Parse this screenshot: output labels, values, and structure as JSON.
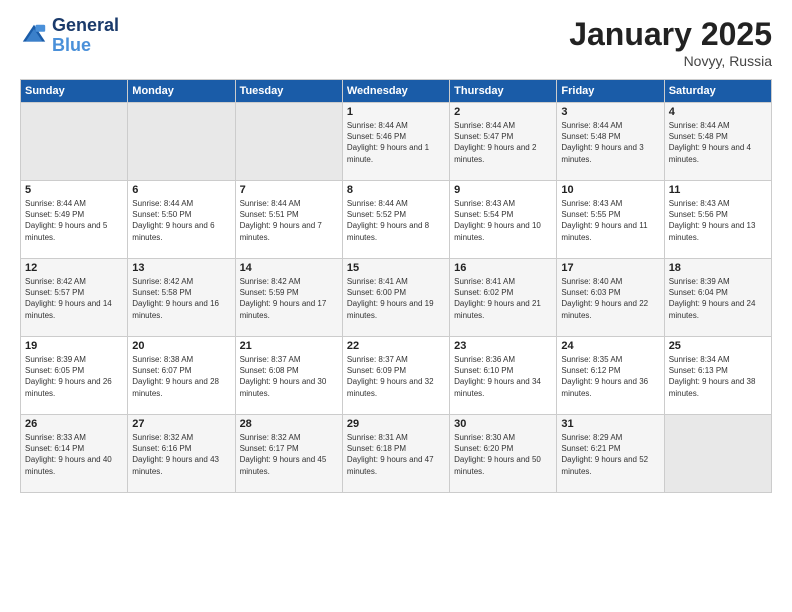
{
  "logo": {
    "text1": "General",
    "text2": "Blue"
  },
  "title": "January 2025",
  "subtitle": "Novyy, Russia",
  "days_of_week": [
    "Sunday",
    "Monday",
    "Tuesday",
    "Wednesday",
    "Thursday",
    "Friday",
    "Saturday"
  ],
  "weeks": [
    [
      {
        "day": "",
        "sunrise": "",
        "sunset": "",
        "daylight": ""
      },
      {
        "day": "",
        "sunrise": "",
        "sunset": "",
        "daylight": ""
      },
      {
        "day": "",
        "sunrise": "",
        "sunset": "",
        "daylight": ""
      },
      {
        "day": "1",
        "sunrise": "Sunrise: 8:44 AM",
        "sunset": "Sunset: 5:46 PM",
        "daylight": "Daylight: 9 hours and 1 minute."
      },
      {
        "day": "2",
        "sunrise": "Sunrise: 8:44 AM",
        "sunset": "Sunset: 5:47 PM",
        "daylight": "Daylight: 9 hours and 2 minutes."
      },
      {
        "day": "3",
        "sunrise": "Sunrise: 8:44 AM",
        "sunset": "Sunset: 5:48 PM",
        "daylight": "Daylight: 9 hours and 3 minutes."
      },
      {
        "day": "4",
        "sunrise": "Sunrise: 8:44 AM",
        "sunset": "Sunset: 5:48 PM",
        "daylight": "Daylight: 9 hours and 4 minutes."
      }
    ],
    [
      {
        "day": "5",
        "sunrise": "Sunrise: 8:44 AM",
        "sunset": "Sunset: 5:49 PM",
        "daylight": "Daylight: 9 hours and 5 minutes."
      },
      {
        "day": "6",
        "sunrise": "Sunrise: 8:44 AM",
        "sunset": "Sunset: 5:50 PM",
        "daylight": "Daylight: 9 hours and 6 minutes."
      },
      {
        "day": "7",
        "sunrise": "Sunrise: 8:44 AM",
        "sunset": "Sunset: 5:51 PM",
        "daylight": "Daylight: 9 hours and 7 minutes."
      },
      {
        "day": "8",
        "sunrise": "Sunrise: 8:44 AM",
        "sunset": "Sunset: 5:52 PM",
        "daylight": "Daylight: 9 hours and 8 minutes."
      },
      {
        "day": "9",
        "sunrise": "Sunrise: 8:43 AM",
        "sunset": "Sunset: 5:54 PM",
        "daylight": "Daylight: 9 hours and 10 minutes."
      },
      {
        "day": "10",
        "sunrise": "Sunrise: 8:43 AM",
        "sunset": "Sunset: 5:55 PM",
        "daylight": "Daylight: 9 hours and 11 minutes."
      },
      {
        "day": "11",
        "sunrise": "Sunrise: 8:43 AM",
        "sunset": "Sunset: 5:56 PM",
        "daylight": "Daylight: 9 hours and 13 minutes."
      }
    ],
    [
      {
        "day": "12",
        "sunrise": "Sunrise: 8:42 AM",
        "sunset": "Sunset: 5:57 PM",
        "daylight": "Daylight: 9 hours and 14 minutes."
      },
      {
        "day": "13",
        "sunrise": "Sunrise: 8:42 AM",
        "sunset": "Sunset: 5:58 PM",
        "daylight": "Daylight: 9 hours and 16 minutes."
      },
      {
        "day": "14",
        "sunrise": "Sunrise: 8:42 AM",
        "sunset": "Sunset: 5:59 PM",
        "daylight": "Daylight: 9 hours and 17 minutes."
      },
      {
        "day": "15",
        "sunrise": "Sunrise: 8:41 AM",
        "sunset": "Sunset: 6:00 PM",
        "daylight": "Daylight: 9 hours and 19 minutes."
      },
      {
        "day": "16",
        "sunrise": "Sunrise: 8:41 AM",
        "sunset": "Sunset: 6:02 PM",
        "daylight": "Daylight: 9 hours and 21 minutes."
      },
      {
        "day": "17",
        "sunrise": "Sunrise: 8:40 AM",
        "sunset": "Sunset: 6:03 PM",
        "daylight": "Daylight: 9 hours and 22 minutes."
      },
      {
        "day": "18",
        "sunrise": "Sunrise: 8:39 AM",
        "sunset": "Sunset: 6:04 PM",
        "daylight": "Daylight: 9 hours and 24 minutes."
      }
    ],
    [
      {
        "day": "19",
        "sunrise": "Sunrise: 8:39 AM",
        "sunset": "Sunset: 6:05 PM",
        "daylight": "Daylight: 9 hours and 26 minutes."
      },
      {
        "day": "20",
        "sunrise": "Sunrise: 8:38 AM",
        "sunset": "Sunset: 6:07 PM",
        "daylight": "Daylight: 9 hours and 28 minutes."
      },
      {
        "day": "21",
        "sunrise": "Sunrise: 8:37 AM",
        "sunset": "Sunset: 6:08 PM",
        "daylight": "Daylight: 9 hours and 30 minutes."
      },
      {
        "day": "22",
        "sunrise": "Sunrise: 8:37 AM",
        "sunset": "Sunset: 6:09 PM",
        "daylight": "Daylight: 9 hours and 32 minutes."
      },
      {
        "day": "23",
        "sunrise": "Sunrise: 8:36 AM",
        "sunset": "Sunset: 6:10 PM",
        "daylight": "Daylight: 9 hours and 34 minutes."
      },
      {
        "day": "24",
        "sunrise": "Sunrise: 8:35 AM",
        "sunset": "Sunset: 6:12 PM",
        "daylight": "Daylight: 9 hours and 36 minutes."
      },
      {
        "day": "25",
        "sunrise": "Sunrise: 8:34 AM",
        "sunset": "Sunset: 6:13 PM",
        "daylight": "Daylight: 9 hours and 38 minutes."
      }
    ],
    [
      {
        "day": "26",
        "sunrise": "Sunrise: 8:33 AM",
        "sunset": "Sunset: 6:14 PM",
        "daylight": "Daylight: 9 hours and 40 minutes."
      },
      {
        "day": "27",
        "sunrise": "Sunrise: 8:32 AM",
        "sunset": "Sunset: 6:16 PM",
        "daylight": "Daylight: 9 hours and 43 minutes."
      },
      {
        "day": "28",
        "sunrise": "Sunrise: 8:32 AM",
        "sunset": "Sunset: 6:17 PM",
        "daylight": "Daylight: 9 hours and 45 minutes."
      },
      {
        "day": "29",
        "sunrise": "Sunrise: 8:31 AM",
        "sunset": "Sunset: 6:18 PM",
        "daylight": "Daylight: 9 hours and 47 minutes."
      },
      {
        "day": "30",
        "sunrise": "Sunrise: 8:30 AM",
        "sunset": "Sunset: 6:20 PM",
        "daylight": "Daylight: 9 hours and 50 minutes."
      },
      {
        "day": "31",
        "sunrise": "Sunrise: 8:29 AM",
        "sunset": "Sunset: 6:21 PM",
        "daylight": "Daylight: 9 hours and 52 minutes."
      },
      {
        "day": "",
        "sunrise": "",
        "sunset": "",
        "daylight": ""
      }
    ]
  ]
}
